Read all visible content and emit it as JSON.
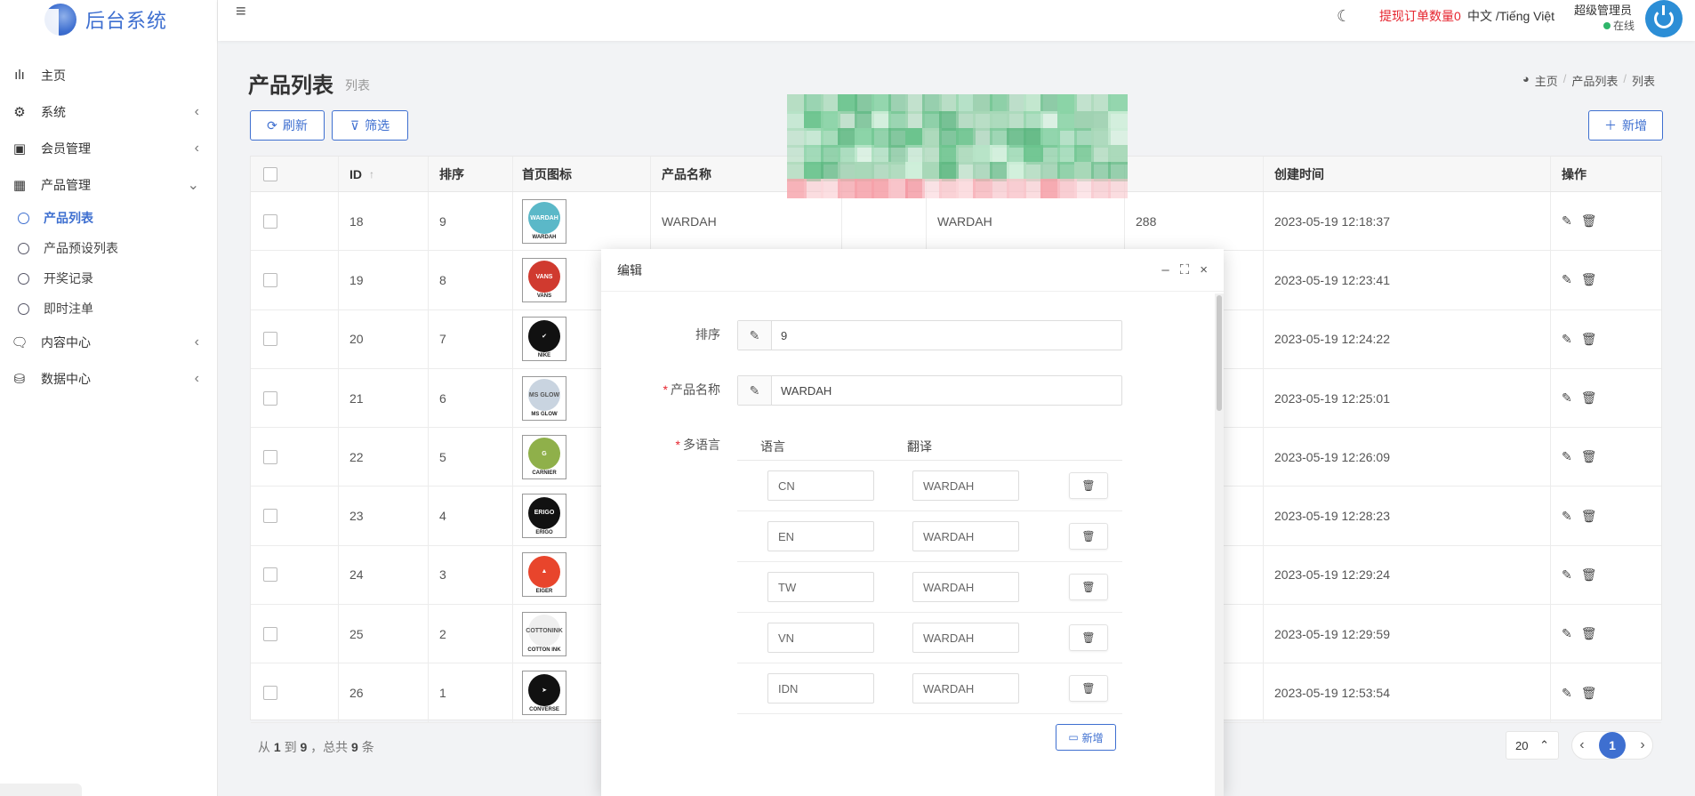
{
  "app": {
    "title": "后台系统"
  },
  "sidebar": {
    "items": [
      {
        "label": "主页",
        "icon": "bar-chart-icon",
        "glyph": "ılı",
        "arrow": ""
      },
      {
        "label": "系统",
        "icon": "gear-icon",
        "glyph": "⚙",
        "arrow": "‹"
      },
      {
        "label": "会员管理",
        "icon": "id-card-icon",
        "glyph": "▣",
        "arrow": "‹"
      },
      {
        "label": "产品管理",
        "icon": "grid-icon",
        "glyph": "▦",
        "arrow": "⌄"
      }
    ],
    "sub_items": [
      {
        "label": "产品列表",
        "active": true
      },
      {
        "label": "产品预设列表"
      },
      {
        "label": "开奖记录"
      },
      {
        "label": "即时注单"
      }
    ],
    "items_after": [
      {
        "label": "内容中心",
        "icon": "chat-icon",
        "glyph": "🗨",
        "arrow": "‹"
      },
      {
        "label": "数据中心",
        "icon": "database-icon",
        "glyph": "⛁",
        "arrow": "‹"
      }
    ]
  },
  "header": {
    "menu_icon": "≡",
    "theme_icon": "☾",
    "pending_label": "提现订单数量",
    "pending_count": "0",
    "language": "中文 /Tiếng Việt",
    "admin_name": "超级管理员",
    "status": "在线"
  },
  "page": {
    "title": "产品列表",
    "subtitle": "列表",
    "breadcrumb": [
      "主页",
      "产品列表",
      "列表"
    ],
    "refresh_label": "刷新",
    "filter_label": "筛选",
    "add_label": "新增"
  },
  "table": {
    "columns": {
      "id": "ID",
      "sort": "排序",
      "icon": "首页图标",
      "name": "产品名称",
      "created": "创建时间",
      "ops": "操作"
    },
    "rows": [
      {
        "id": "18",
        "sort": "9",
        "brand": "WARDAH",
        "logo_text": "WARDAH",
        "color": "#5bb8c8",
        "name": "WARDAH",
        "extra1": "WARDAH",
        "extra2": "288",
        "created": "2023-05-19 12:18:37"
      },
      {
        "id": "19",
        "sort": "8",
        "brand": "VANS",
        "logo_text": "VANS",
        "color": "#d03a2f",
        "created": "2023-05-19 12:23:41"
      },
      {
        "id": "20",
        "sort": "7",
        "brand": "NIKE",
        "logo_text": "✔",
        "color": "#111111",
        "created": "2023-05-19 12:24:22"
      },
      {
        "id": "21",
        "sort": "6",
        "brand": "MS GLOW",
        "logo_text": "MS GLOW",
        "color": "#c9d4e0",
        "created": "2023-05-19 12:25:01"
      },
      {
        "id": "22",
        "sort": "5",
        "brand": "CARNIER",
        "logo_text": "G",
        "color": "#8fb04a",
        "created": "2023-05-19 12:26:09"
      },
      {
        "id": "23",
        "sort": "4",
        "brand": "ERIGO",
        "logo_text": "ERIGO",
        "color": "#111111",
        "created": "2023-05-19 12:28:23"
      },
      {
        "id": "24",
        "sort": "3",
        "brand": "EIGER",
        "logo_text": "▲",
        "color": "#e8452c",
        "created": "2023-05-19 12:29:24"
      },
      {
        "id": "25",
        "sort": "2",
        "brand": "COTTON INK",
        "logo_text": "COTTONINK",
        "color": "#efefef",
        "created": "2023-05-19 12:29:59"
      },
      {
        "id": "26",
        "sort": "1",
        "brand": "CONVERSE",
        "logo_text": "➤",
        "color": "#111111",
        "created": "2023-05-19 12:53:54"
      }
    ],
    "footer": {
      "from": "1",
      "to": "9",
      "total": "9"
    },
    "page_size": "20",
    "current_page": "1"
  },
  "modal": {
    "title": "编辑",
    "sort_label": "排序",
    "sort_value": "9",
    "name_label": "产品名称",
    "name_value": "WARDAH",
    "multilang_label": "多语言",
    "lang_col": "语言",
    "trans_col": "翻译",
    "languages": [
      {
        "code": "CN",
        "text": "WARDAH"
      },
      {
        "code": "EN",
        "text": "WARDAH"
      },
      {
        "code": "TW",
        "text": "WARDAH"
      },
      {
        "code": "VN",
        "text": "WARDAH"
      },
      {
        "code": "IDN",
        "text": "WARDAH"
      }
    ],
    "add_label": "新增"
  }
}
